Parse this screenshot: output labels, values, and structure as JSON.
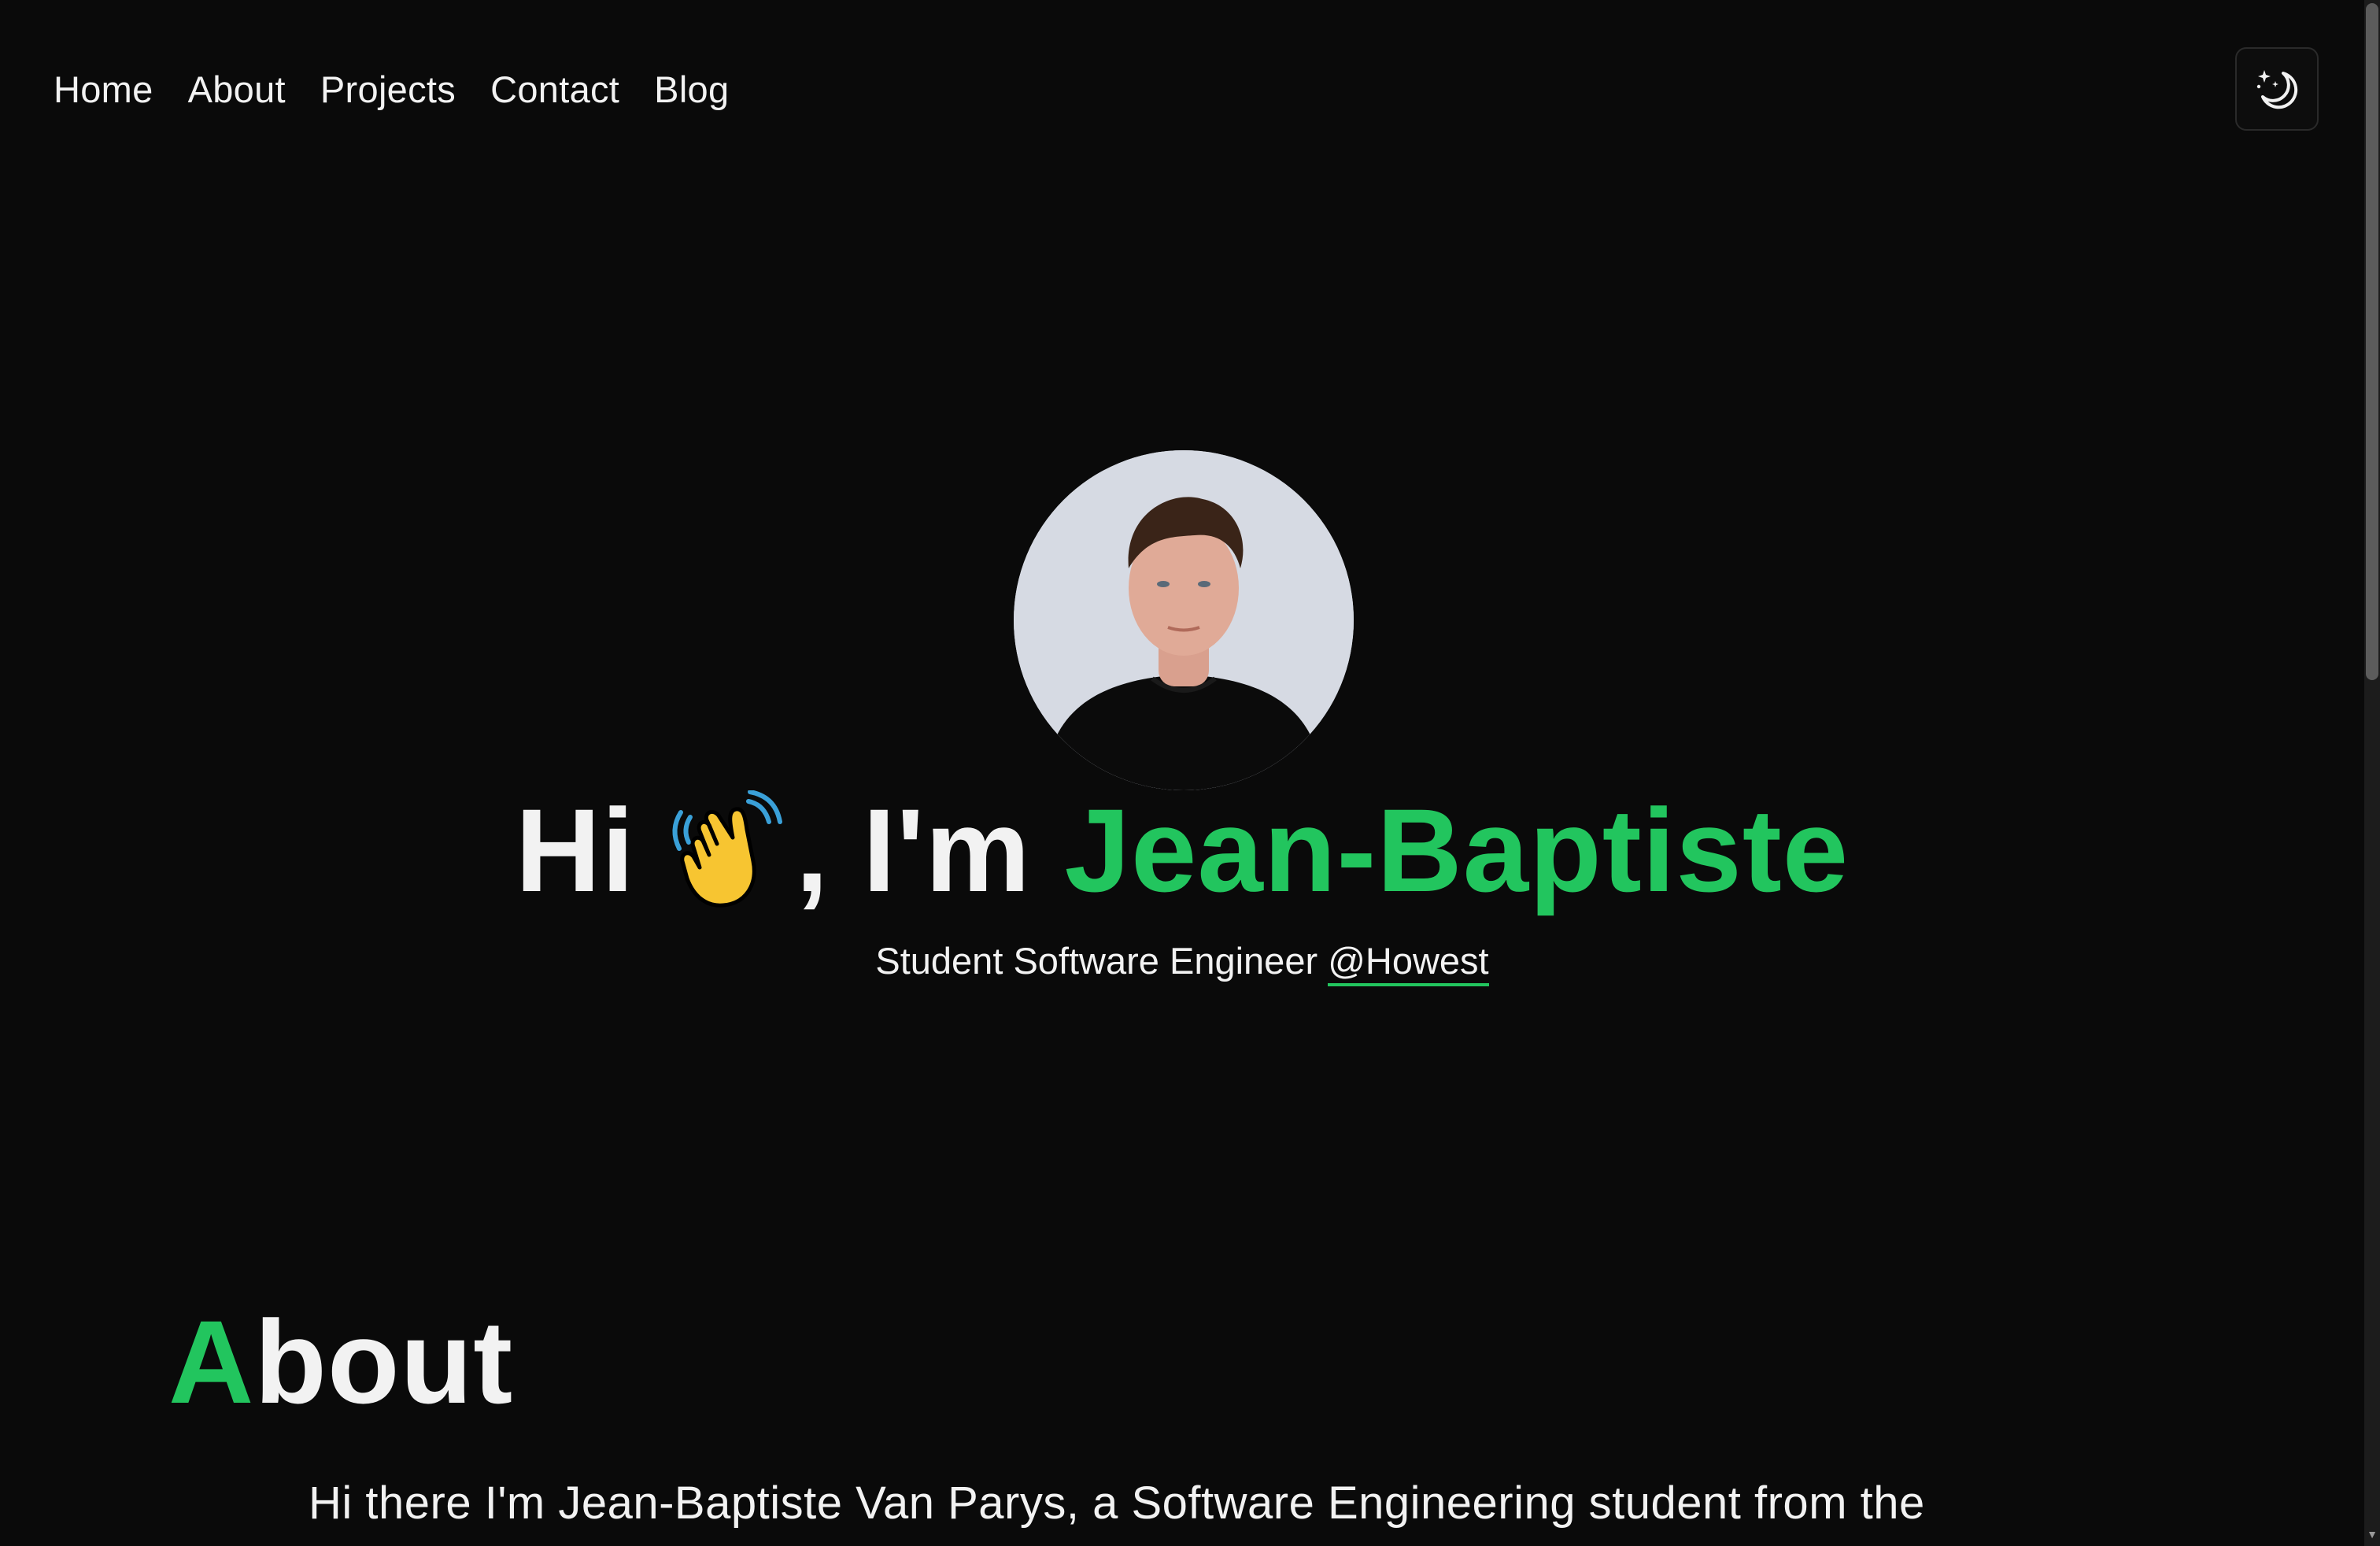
{
  "nav": {
    "items": [
      {
        "label": "Home"
      },
      {
        "label": "About"
      },
      {
        "label": "Projects"
      },
      {
        "label": "Contact"
      },
      {
        "label": "Blog"
      }
    ],
    "theme_toggle_icon": "moon-stars-icon"
  },
  "hero": {
    "greeting": "Hi",
    "wave_icon": "waving-hand-icon",
    "intro": ", I'm",
    "name": "Jean-Baptiste",
    "subtitle": "Student Software Engineer",
    "subtitle_link": "@Howest"
  },
  "about": {
    "heading_first_letter": "A",
    "heading_rest": "bout",
    "text": "Hi there I'm Jean-Baptiste Van Parys, a Software Engineering student from the"
  },
  "colors": {
    "accent": "#22c55e",
    "background": "#0a0a0a",
    "text": "#f2f2f2"
  }
}
